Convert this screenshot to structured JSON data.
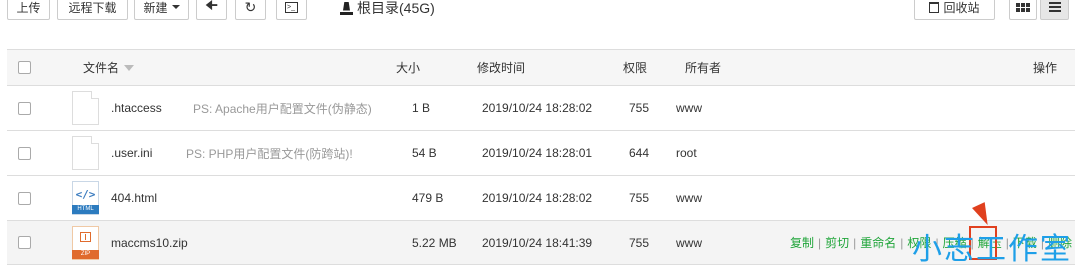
{
  "toolbar": {
    "upload": "上传",
    "remote_download": "远程下载",
    "new": "新建",
    "path": "根目录(45G)",
    "recycle_bin": "回收站"
  },
  "table": {
    "headers": {
      "name": "文件名",
      "size": "大小",
      "mtime": "修改时间",
      "perm": "权限",
      "owner": "所有者",
      "ops": "操作"
    },
    "rows": [
      {
        "name": ".htaccess",
        "ps": "PS: Apache用户配置文件(伪静态)",
        "size": "1 B",
        "mtime": "2019/10/24 18:28:02",
        "perm": "755",
        "owner": "www",
        "icon": "file-icon"
      },
      {
        "name": ".user.ini",
        "ps": "PS: PHP用户配置文件(防跨站)!",
        "size": "54 B",
        "mtime": "2019/10/24 18:28:01",
        "perm": "644",
        "owner": "root",
        "icon": "file-icon"
      },
      {
        "name": "404.html",
        "ps": "",
        "size": "479 B",
        "mtime": "2019/10/24 18:28:02",
        "perm": "755",
        "owner": "www",
        "icon": "html-file-icon",
        "icon_text": "HTML"
      },
      {
        "name": "maccms10.zip",
        "ps": "",
        "size": "5.22 MB",
        "mtime": "2019/10/24 18:41:39",
        "perm": "755",
        "owner": "www",
        "icon": "zip-file-icon",
        "icon_text": "ZIP"
      }
    ],
    "row_actions": [
      "复制",
      "剪切",
      "重命名",
      "权限",
      "压缩",
      "解压",
      "下载",
      "删除"
    ]
  },
  "watermark": "小志工作室",
  "colors": {
    "action_green": "#20a53a",
    "watermark_blue": "#1e9fe8",
    "highlight_red": "#e0401e"
  }
}
